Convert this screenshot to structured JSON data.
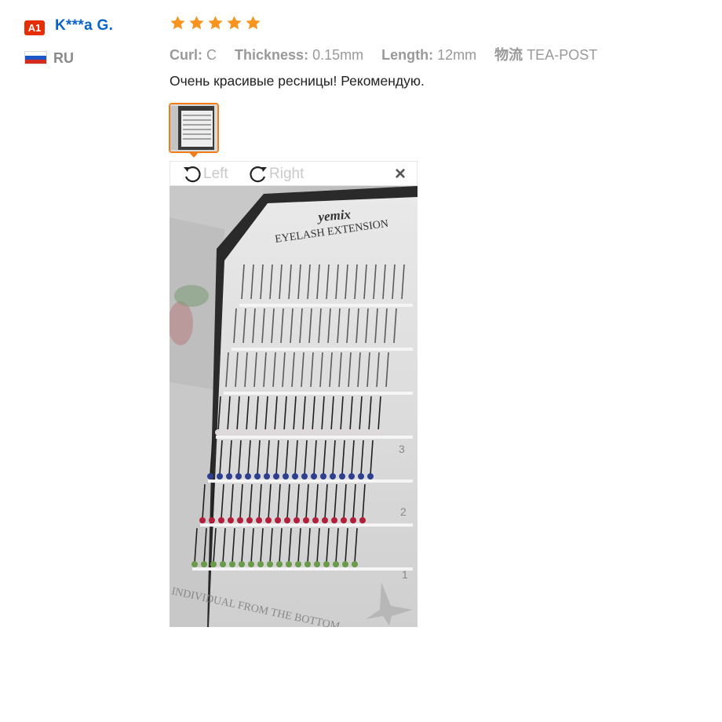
{
  "user": {
    "level_badge": "A1",
    "name": "K***a G.",
    "country_code": "RU",
    "flag_colors": [
      "#ffffff",
      "#1c57c7",
      "#d52b1e"
    ]
  },
  "review": {
    "rating": 5,
    "star_color": "#f7931e",
    "attributes": [
      {
        "key": "Curl:",
        "value": "C"
      },
      {
        "key": "Thickness:",
        "value": "0.15mm"
      },
      {
        "key": "Length:",
        "value": "12mm"
      },
      {
        "key": "物流",
        "value": "TEA-POST"
      }
    ],
    "text": "Очень красивые ресницы! Рекомендую."
  },
  "viewer": {
    "rotate_left_label": "Left",
    "rotate_right_label": "Right",
    "close_label": "×"
  },
  "photo": {
    "brand": "yemix",
    "header": "EYELASH EXTENSION",
    "footer": "INDIVIDUAL FROM THE BOTTOM",
    "row_numbers": [
      "3",
      "2",
      "1"
    ]
  }
}
